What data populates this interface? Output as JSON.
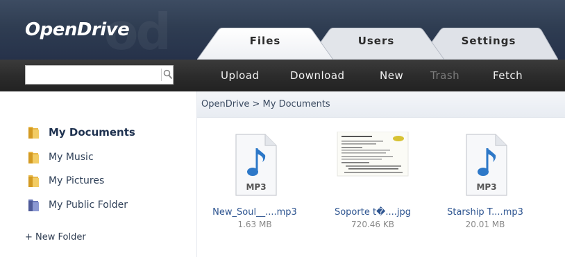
{
  "app": {
    "logo_text": "OpenDrive",
    "logo_ghost": "od"
  },
  "tabs": [
    {
      "label": "Files",
      "active": true
    },
    {
      "label": "Users",
      "active": false
    },
    {
      "label": "Settings",
      "active": false
    }
  ],
  "search": {
    "value": "",
    "placeholder": ""
  },
  "toolbar": {
    "items": [
      {
        "label": "Upload",
        "enabled": true
      },
      {
        "label": "Download",
        "enabled": true
      },
      {
        "label": "New",
        "enabled": true
      },
      {
        "label": "Trash",
        "enabled": false
      },
      {
        "label": "Fetch",
        "enabled": true
      }
    ]
  },
  "breadcrumb": "OpenDrive > My Documents",
  "sidebar": {
    "items": [
      {
        "label": "My Documents",
        "active": true,
        "icon": "folder-icon"
      },
      {
        "label": "My Music",
        "active": false,
        "icon": "folder-icon"
      },
      {
        "label": "My Pictures",
        "active": false,
        "icon": "folder-icon"
      },
      {
        "label": "My Public Folder",
        "active": false,
        "icon": "public-folder-icon"
      }
    ],
    "new_folder": "+ New Folder"
  },
  "files": [
    {
      "name": "New_Soul__....mp3",
      "size": "1.63 MB",
      "icon": "mp3-file-icon",
      "badge": "MP3"
    },
    {
      "name": "Soporte t�....jpg",
      "size": "720.46 KB",
      "icon": "image-thumbnail"
    },
    {
      "name": "Starship T....mp3",
      "size": "20.01 MB",
      "icon": "mp3-file-icon",
      "badge": "MP3"
    }
  ],
  "colors": {
    "header": "#2f3d52",
    "toolbar": "#2c2c2c",
    "link": "#2d5490",
    "folder": "#e8b84a",
    "public_folder": "#6a78b8",
    "music_note": "#2d78c8"
  }
}
